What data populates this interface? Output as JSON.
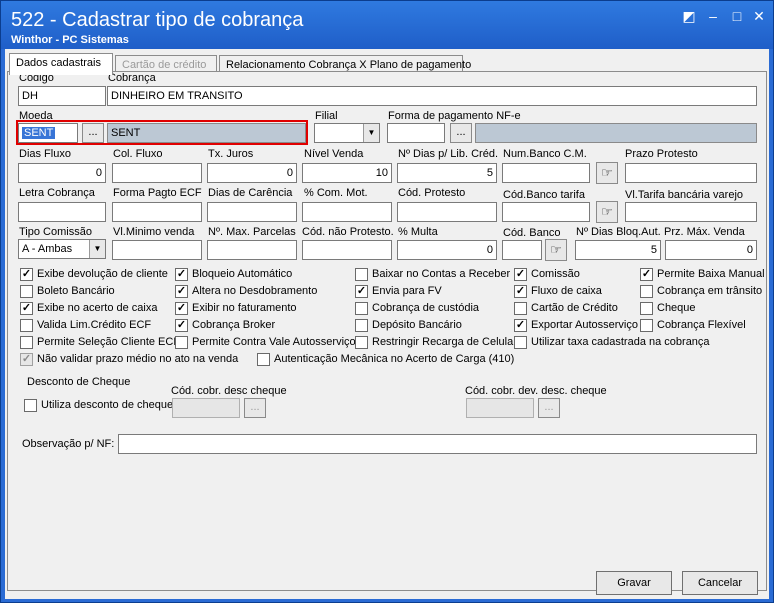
{
  "window": {
    "title": "522 - Cadastrar tipo de cobrança",
    "subtitle": "Winthor - PC Sistemas"
  },
  "tabs": [
    {
      "label": "Dados cadastrais",
      "active": true
    },
    {
      "label": "Cartão de crédito",
      "disabled": true
    },
    {
      "label": "Relacionamento Cobrança X Plano de pagamento"
    }
  ],
  "fields": {
    "codigo": {
      "label": "Código",
      "value": "DH"
    },
    "cobranca": {
      "label": "Cobrança",
      "value": "DINHEIRO EM TRANSITO"
    },
    "moeda": {
      "label": "Moeda",
      "code": "SENT",
      "desc": "SENT"
    },
    "filial": {
      "label": "Filial",
      "value": ""
    },
    "forma_pag_nfe": {
      "label": "Forma de pagamento NF-e",
      "code": "",
      "desc": ""
    },
    "dias_fluxo": {
      "label": "Dias Fluxo",
      "value": "0"
    },
    "col_fluxo": {
      "label": "Col. Fluxo",
      "value": ""
    },
    "tx_juros": {
      "label": "Tx. Juros",
      "value": "0"
    },
    "nivel_venda": {
      "label": "Nível Venda",
      "value": "10"
    },
    "n_dias_lib_cred": {
      "label": "Nº Dias p/ Lib. Créd.",
      "value": "5"
    },
    "num_banco_cm": {
      "label": "Num.Banco C.M.",
      "value": ""
    },
    "prazo_protesto": {
      "label": "Prazo Protesto",
      "value": ""
    },
    "letra_cobranca": {
      "label": "Letra Cobrança",
      "value": ""
    },
    "forma_pagto_ecf": {
      "label": "Forma Pagto ECF",
      "value": ""
    },
    "dias_carencia": {
      "label": "Dias de Carência",
      "value": ""
    },
    "com_mot": {
      "label": "% Com. Mot.",
      "value": ""
    },
    "cod_protesto": {
      "label": "Cód. Protesto",
      "value": ""
    },
    "cod_banco_tarifa": {
      "label": "Cód.Banco tarifa",
      "value": ""
    },
    "vl_tarifa_bancaria": {
      "label": "Vl.Tarifa bancária varejo",
      "value": ""
    },
    "tipo_comissao": {
      "label": "Tipo Comissão",
      "value": "A - Ambas"
    },
    "vl_minimo_venda": {
      "label": "Vl.Minimo venda",
      "value": ""
    },
    "n_max_parcelas": {
      "label": "Nº. Max. Parcelas",
      "value": ""
    },
    "cod_nao_protesto": {
      "label": "Cód. não Protesto.",
      "value": ""
    },
    "pct_multa": {
      "label": "% Multa",
      "value": "0"
    },
    "cod_banco": {
      "label": "Cód. Banco",
      "value": ""
    },
    "n_dias_bloq_aut": {
      "label": "Nº Dias Bloq.Aut.",
      "value": "5"
    },
    "prz_max_venda": {
      "label": "Prz. Máx. Venda",
      "value": "0"
    }
  },
  "checkboxes": {
    "col1": [
      {
        "label": "Exibe devolução de cliente",
        "checked": true
      },
      {
        "label": "Boleto Bancário",
        "checked": false
      },
      {
        "label": "Exibe no acerto de caixa",
        "checked": true
      },
      {
        "label": "Valida Lim.Crédito ECF",
        "checked": false
      },
      {
        "label": "Permite Seleção Cliente ECF",
        "checked": false
      }
    ],
    "col2": [
      {
        "label": "Bloqueio Automático",
        "checked": true
      },
      {
        "label": "Altera no Desdobramento",
        "checked": true
      },
      {
        "label": "Exibir no faturamento",
        "checked": true
      },
      {
        "label": "Cobrança Broker",
        "checked": true
      },
      {
        "label": "Permite Contra Vale Autosserviço",
        "checked": false
      }
    ],
    "col3": [
      {
        "label": "Baixar no Contas a Receber",
        "checked": false
      },
      {
        "label": "Envia para FV",
        "checked": true
      },
      {
        "label": "Cobrança de custódia",
        "checked": false
      },
      {
        "label": "Depósito Bancário",
        "checked": false
      },
      {
        "label": "Restringir Recarga de Celular",
        "checked": false
      }
    ],
    "col4": [
      {
        "label": "Comissão",
        "checked": true
      },
      {
        "label": "Fluxo de caixa",
        "checked": true
      },
      {
        "label": "Cartão de Crédito",
        "checked": false
      },
      {
        "label": "Exportar Autosserviço",
        "checked": true
      },
      {
        "label": "Utilizar taxa cadastrada na cobrança",
        "checked": false
      }
    ],
    "col5": [
      {
        "label": "Permite Baixa Manual",
        "checked": true
      },
      {
        "label": "Cobrança em trânsito",
        "checked": false
      },
      {
        "label": "Cheque",
        "checked": false
      },
      {
        "label": "Cobrança Flexível",
        "checked": false
      }
    ],
    "row6": [
      {
        "label": "Não validar prazo médio no ato na venda",
        "checked": true,
        "disabled": true
      },
      {
        "label": "Autenticação Mecânica no Acerto de Carga (410)",
        "checked": false
      }
    ]
  },
  "desconto_cheque": {
    "title": "Desconto de Cheque",
    "utiliza": {
      "label": "Utiliza desconto de cheque",
      "checked": false
    },
    "cod_desc": {
      "label": "Cód. cobr. desc cheque",
      "value": ""
    },
    "cod_dev": {
      "label": "Cód. cobr. dev. desc. cheque",
      "value": ""
    }
  },
  "observacao": {
    "label": "Observação p/ NF:",
    "value": ""
  },
  "buttons": {
    "gravar": "Gravar",
    "cancelar": "Cancelar",
    "ellipsis": "..."
  },
  "icons": {
    "check": "✓",
    "lookup": "☞",
    "dropdown": "▼"
  }
}
